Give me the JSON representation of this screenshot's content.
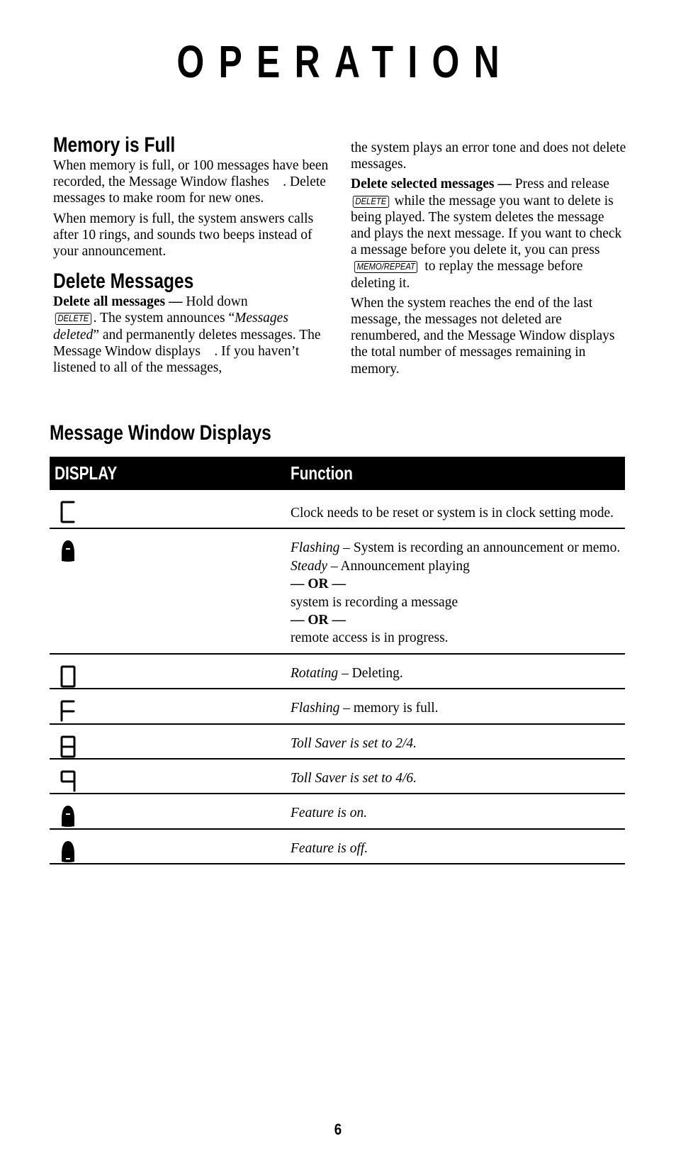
{
  "page_title": "OPERATION",
  "left_column": {
    "memory_full": {
      "heading": "Memory is Full",
      "para1": "When memory is full, or 100 messages have been recorded, the Message Window flashes   . Delete messages to make room for new ones.",
      "para2": "When memory is full, the system answers calls after 10 rings, and sounds two beeps instead of your announcement."
    },
    "delete_messages": {
      "heading": "Delete Messages",
      "all_label": "Delete all messages —",
      "all_text_1": " Hold down ",
      "delete_key": "DELETE",
      "all_text_2": ". The system announces “",
      "all_italic": "Messages deleted",
      "all_text_3": "” and permanently deletes messages. The Message Window displays   . If you haven’t listened to all of the messages,"
    }
  },
  "right_column": {
    "continuation": "the system plays an error tone and does not delete messages.",
    "selected_label": "Delete selected messages —",
    "selected_text_1": " Press and release ",
    "delete_key": "DELETE",
    "selected_text_2": " while the message you want to delete is being played. The system deletes the message and plays the next message.  If you want to check a message before you delete it, you can press ",
    "memo_key": "MEMO/REPEAT",
    "selected_text_3": " to replay the message before deleting it.",
    "end_para": "When the system reaches the end of the last message, the messages not deleted are renumbered, and the Message Window displays the total number of messages remaining in memory."
  },
  "table": {
    "title": "Message Window Displays",
    "headers": {
      "display": "DISPLAY",
      "function": "Function"
    },
    "rows": [
      {
        "display_icon": "segment-c",
        "lines": [
          {
            "parts": [
              {
                "t": "Clock needs to be reset or system is in clock setting mode.",
                "s": "n"
              }
            ]
          }
        ]
      },
      {
        "display_icon": "bullet-top-dash",
        "lines": [
          {
            "parts": [
              {
                "t": "Flashing",
                "s": "i"
              },
              {
                "t": " – System is recording an announcement or memo.",
                "s": "n"
              }
            ]
          },
          {
            "parts": [
              {
                "t": "Steady",
                "s": "i"
              },
              {
                "t": " – Announcement playing",
                "s": "n"
              }
            ]
          },
          {
            "parts": [
              {
                "t": "— OR —",
                "s": "b"
              }
            ]
          },
          {
            "parts": [
              {
                "t": "system is recording a message",
                "s": "n"
              }
            ]
          },
          {
            "parts": [
              {
                "t": "— OR —",
                "s": "b"
              }
            ]
          },
          {
            "parts": [
              {
                "t": "remote access is in progress.",
                "s": "n"
              }
            ]
          }
        ]
      },
      {
        "display_icon": "segment-0",
        "lines": [
          {
            "parts": [
              {
                "t": "Rotating",
                "s": "i"
              },
              {
                "t": " – Deleting.",
                "s": "n"
              }
            ]
          }
        ]
      },
      {
        "display_icon": "segment-f",
        "lines": [
          {
            "parts": [
              {
                "t": "Flashing",
                "s": "i"
              },
              {
                "t": " – memory is full.",
                "s": "n"
              }
            ]
          }
        ]
      },
      {
        "display_icon": "segment-8",
        "lines": [
          {
            "parts": [
              {
                "t": "Toll Saver is set to 2/4.",
                "s": "i"
              }
            ]
          }
        ]
      },
      {
        "display_icon": "segment-9",
        "lines": [
          {
            "parts": [
              {
                "t": "Toll Saver is set to 4/6.",
                "s": "i"
              }
            ]
          }
        ]
      },
      {
        "display_icon": "bullet-top-dash",
        "lines": [
          {
            "parts": [
              {
                "t": "Feature is on.",
                "s": "i"
              }
            ]
          }
        ]
      },
      {
        "display_icon": "bullet-bottom-dash",
        "lines": [
          {
            "parts": [
              {
                "t": "Feature is off.",
                "s": "i"
              }
            ]
          }
        ]
      }
    ]
  },
  "page_number": "6"
}
